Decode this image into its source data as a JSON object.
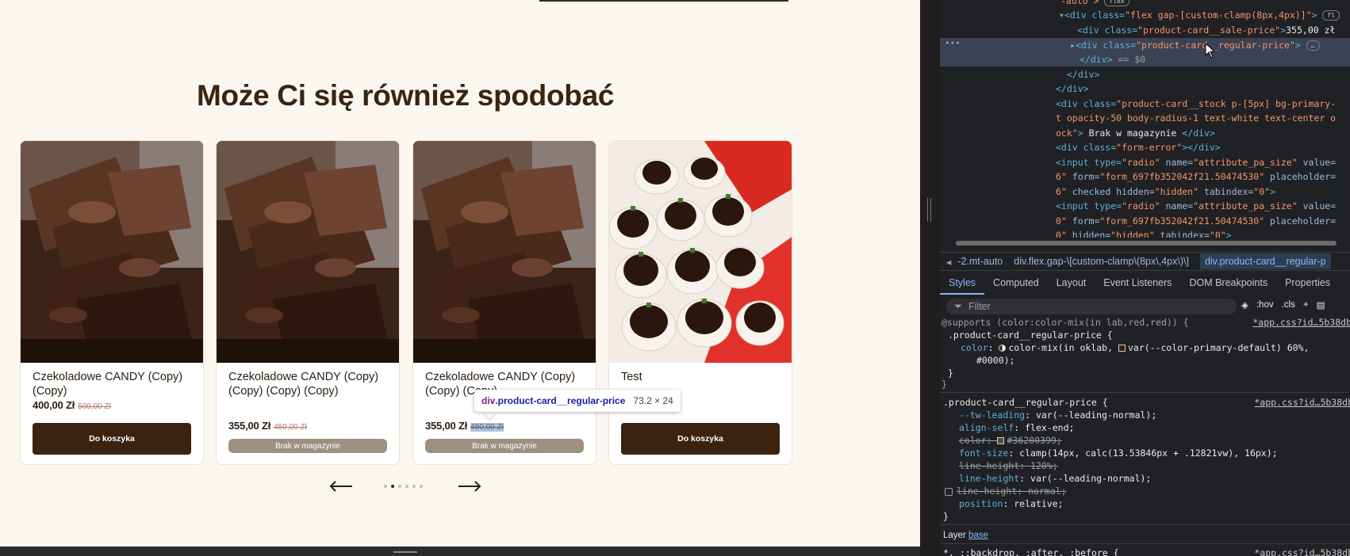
{
  "page": {
    "section_title": "Może Ci się również spodobać",
    "products": [
      {
        "title": "Czekoladowe CANDY (Copy) (Copy)",
        "sale_price": "400,00 Zł",
        "regular_price": "500,00 Zł",
        "action": "Do koszyka",
        "image": "chocolate-pieces"
      },
      {
        "title": "Czekoladowe CANDY (Copy) (Copy) (Copy) (Copy)",
        "sale_price": "355,00 Zł",
        "regular_price": "450,00 Zł",
        "stock": "Brak w magazynie",
        "image": "chocolate-pieces"
      },
      {
        "title": "Czekoladowe CANDY (Copy) (Copy) (Copy)",
        "sale_price": "355,00 Zł",
        "regular_price": "450,00 Zł",
        "stock": "Brak w magazynie",
        "image": "chocolate-pieces"
      },
      {
        "title": "Test",
        "action": "Do koszyka",
        "image": "chocolate-strawberries"
      }
    ],
    "inspector_tooltip": {
      "tag": "div",
      "class": ".product-card__regular-price",
      "size": "73.2 × 24"
    },
    "carousel": {
      "prev_icon": "arrow-left-icon",
      "next_icon": "arrow-right-icon",
      "dot_count": 6,
      "active_dot": 1
    }
  },
  "devtools": {
    "elements": {
      "lines": [
        {
          "text_before": "-auto\">",
          "badge": "flex"
        },
        {
          "tag_open": "<div class=",
          "value": "\"flex gap-[custom-clamp(8px,4px)]\"",
          "tag_close": ">",
          "badge": "fl"
        },
        {
          "tag_open": "<div class=",
          "value": "\"product-card__sale-price\"",
          "tag_close": ">",
          "text": "355,00 zł"
        },
        {
          "tag_open": "<div class=",
          "value": "\"product-card__regular-price\"",
          "tag_close": ">",
          "ellipsis": "…"
        },
        {
          "tag": "</div>",
          "suffix": "== $0"
        },
        {
          "tag": "</div>"
        },
        {
          "tag": "</div>"
        },
        {
          "tag_open": "<div class=",
          "value": "\"product-card__stock p-[5px] bg-primary-"
        },
        {
          "value": "t opacity-50 body-radius-1 text-white text-center o"
        },
        {
          "value": "ock\"",
          "tag_close": ">",
          "text": " Brak w magazynie ",
          "tag": "</div>"
        },
        {
          "tag_open": "<div class=",
          "value": "\"form-error\"",
          "tag_close": "></div>"
        },
        {
          "tag_open": "<input type=",
          "value": "\"radio\"",
          "attr2": " name=",
          "value2": "\"attribute_pa_size\"",
          "attr3": " value="
        },
        {
          "value": "6\"",
          "attr2": " form=",
          "value2": "\"form_697fb352042f21.50474530\"",
          "attr3": " placeholder="
        },
        {
          "value": "6\"",
          "attr2": " checked hidden=",
          "value2": "\"hidden\"",
          "attr3": " tabindex=",
          "value3": "\"0\"",
          "tag_close": ">"
        },
        {
          "tag_open": "<input type=",
          "value": "\"radio\"",
          "attr2": " name=",
          "value2": "\"attribute_pa_size\"",
          "attr3": " value="
        },
        {
          "value": "0\"",
          "attr2": " form=",
          "value2": "\"form_697fb352042f21.50474530\"",
          "attr3": " placeholder="
        },
        {
          "value": "0\"",
          "attr2": " hidden=",
          "value2": "\"hidden\"",
          "attr3": " tabindex=",
          "value3": "\"0\"",
          "tag_close": ">"
        }
      ]
    },
    "breadcrumbs": [
      "-2.mt-auto",
      "div.flex.gap-\\[custom-clamp\\(8px\\,4px\\)\\]",
      "div.product-card__regular-p"
    ],
    "tabs": [
      "Styles",
      "Computed",
      "Layout",
      "Event Listeners",
      "DOM Breakpoints",
      "Properties"
    ],
    "active_tab": "Styles",
    "filter_placeholder": "Filter",
    "filter_tools": [
      ":hov",
      ".cls",
      "+"
    ],
    "styles": {
      "rule1": {
        "at_rule": "@supports (color:color-mix(in lab,red,red)) {",
        "source": "*app.css?id…5b38db",
        "selector": ".product-card__regular-price {",
        "prop": "color",
        "value_a": "color-mix(in oklab, ",
        "value_b": "var(--color-primary-default) 60%, ",
        "value_c": "#0000);",
        "close": "}",
        "close_outer": "}"
      },
      "rule2": {
        "selector": ".product-card__regular-price {",
        "source": "*app.css?id…5b38db",
        "decls": [
          {
            "prop": "--tw-leading",
            "value": "var(--leading-normal);"
          },
          {
            "prop": "align-self",
            "value": "flex-end;"
          },
          {
            "prop": "color",
            "value": "#36200399;",
            "struck": true
          },
          {
            "prop": "font-size",
            "value": "clamp(14px, calc(13.53846px + .12821vw), 16px);"
          },
          {
            "prop": "line-height",
            "value": "120%;",
            "struck": true
          },
          {
            "prop": "line-height",
            "value": "var(--leading-normal);"
          },
          {
            "prop": "line-height",
            "value": "normal;",
            "struck": true
          },
          {
            "prop": "position",
            "value": "relative;"
          }
        ],
        "close": "}"
      },
      "layer_label": "Layer",
      "layer_name": "base",
      "rule3": {
        "selector": "*, ::backdrop, :after, :before {",
        "source": "*app.css?id…5b38db"
      }
    },
    "colors": {
      "struck_swatch": "#362003",
      "primary_swatch": "#3b2310"
    }
  }
}
